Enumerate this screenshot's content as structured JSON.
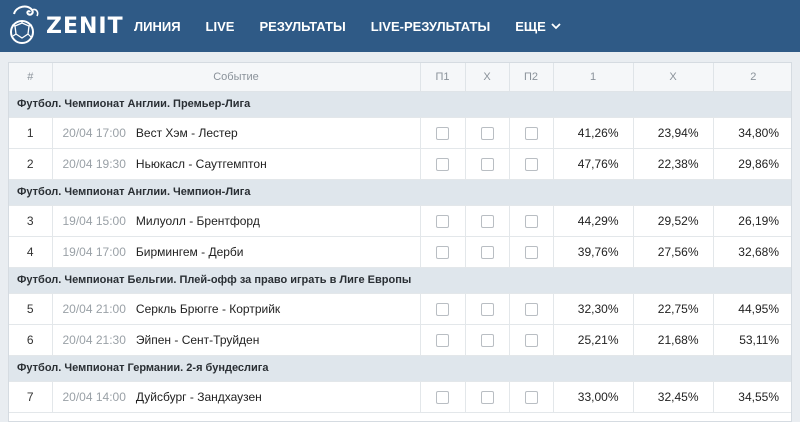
{
  "brand": {
    "name": "ZENIT"
  },
  "nav": [
    {
      "label": "ЛИНИЯ"
    },
    {
      "label": "LIVE"
    },
    {
      "label": "РЕЗУЛЬТАТЫ"
    },
    {
      "label": "LIVE-РЕЗУЛЬТАТЫ"
    },
    {
      "label": "ЕЩЕ"
    }
  ],
  "table": {
    "headers": {
      "num": "#",
      "event": "Событие",
      "p1": "П1",
      "x": "Х",
      "p2": "П2",
      "c1": "1",
      "cx": "Х",
      "c2": "2"
    },
    "leagues": [
      {
        "name": "Футбол. Чемпионат Англии. Премьер-Лига",
        "rows": [
          {
            "num": "1",
            "time": "20/04 17:00",
            "teams": "Вест Хэм - Лестер",
            "p1": "41,26%",
            "x": "23,94%",
            "p2": "34,80%"
          },
          {
            "num": "2",
            "time": "20/04 19:30",
            "teams": "Ньюкасл - Саутгемптон",
            "p1": "47,76%",
            "x": "22,38%",
            "p2": "29,86%"
          }
        ]
      },
      {
        "name": "Футбол. Чемпионат Англии. Чемпион-Лига",
        "rows": [
          {
            "num": "3",
            "time": "19/04 15:00",
            "teams": "Милуолл - Брентфорд",
            "p1": "44,29%",
            "x": "29,52%",
            "p2": "26,19%"
          },
          {
            "num": "4",
            "time": "19/04 17:00",
            "teams": "Бирмингем - Дерби",
            "p1": "39,76%",
            "x": "27,56%",
            "p2": "32,68%"
          }
        ]
      },
      {
        "name": "Футбол. Чемпионат Бельгии. Плей-офф за право играть в Лиге Европы",
        "rows": [
          {
            "num": "5",
            "time": "20/04 21:00",
            "teams": "Серкль Брюгге - Кортрийк",
            "p1": "32,30%",
            "x": "22,75%",
            "p2": "44,95%"
          },
          {
            "num": "6",
            "time": "20/04 21:30",
            "teams": "Эйпен - Сент-Труйден",
            "p1": "25,21%",
            "x": "21,68%",
            "p2": "53,11%"
          }
        ]
      },
      {
        "name": "Футбол. Чемпионат Германии. 2-я бундеслига",
        "rows": [
          {
            "num": "7",
            "time": "20/04 14:00",
            "teams": "Дуйсбург - Зандхаузен",
            "p1": "33,00%",
            "x": "32,45%",
            "p2": "34,55%"
          }
        ]
      }
    ]
  }
}
